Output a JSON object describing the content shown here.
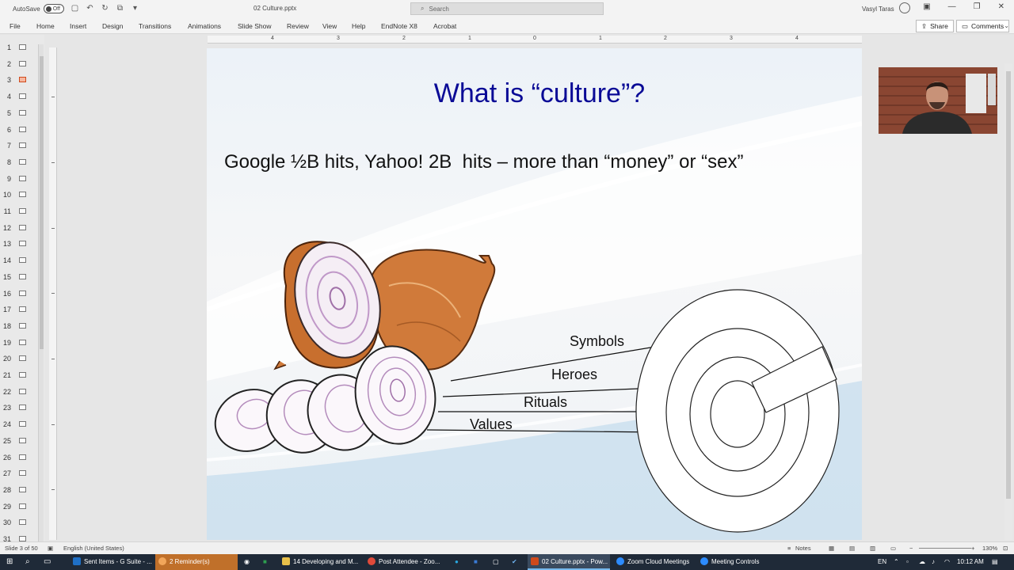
{
  "titlebar": {
    "autosave_label": "AutoSave",
    "autosave_state": "Off",
    "doc_title": "02 Culture.pptx",
    "search_placeholder": "Search",
    "user_name": "Vasyl Taras"
  },
  "ribbon": {
    "tabs": [
      "File",
      "Home",
      "Insert",
      "Design",
      "Transitions",
      "Animations",
      "Slide Show",
      "Review",
      "View",
      "Help",
      "EndNote X8",
      "Acrobat"
    ],
    "share_label": "Share",
    "comments_label": "Comments"
  },
  "ruler": {
    "labels": [
      "4",
      "3",
      "2",
      "1",
      "0",
      "1",
      "2",
      "3",
      "4"
    ]
  },
  "thumbnails": {
    "numbers": [
      "1",
      "2",
      "3",
      "4",
      "5",
      "6",
      "7",
      "8",
      "9",
      "10",
      "11",
      "12",
      "13",
      "14",
      "15",
      "16",
      "17",
      "18",
      "19",
      "20",
      "21",
      "22",
      "23",
      "24",
      "25",
      "26",
      "27",
      "28",
      "29",
      "30",
      "31"
    ],
    "selected_index": 3
  },
  "slide": {
    "title": "What is “culture”?",
    "subtitle": "Google ½B hits, Yahoo! 2B  hits – more than “money” or “sex”",
    "labels": {
      "symbols": "Symbols",
      "heroes": "Heroes",
      "rituals": "Rituals",
      "values": "Values"
    }
  },
  "statusbar": {
    "slide_info": "Slide 3 of 50",
    "language": "English (United States)",
    "notes_label": "Notes",
    "zoom": "130%"
  },
  "taskbar": {
    "items": [
      "Sent Items - G Suite - ...",
      "2 Reminder(s)",
      "14 Developing and M...",
      "Post Attendee - Zoo...",
      "02 Culture.pptx - Pow...",
      "Zoom Cloud Meetings",
      "Meeting Controls"
    ],
    "lang": "EN",
    "time": "10:12 AM"
  },
  "colors": {
    "title_blue": "#0a0a96",
    "accent_orange": "#d04a1c",
    "taskbar_bg": "#1f2a38"
  }
}
